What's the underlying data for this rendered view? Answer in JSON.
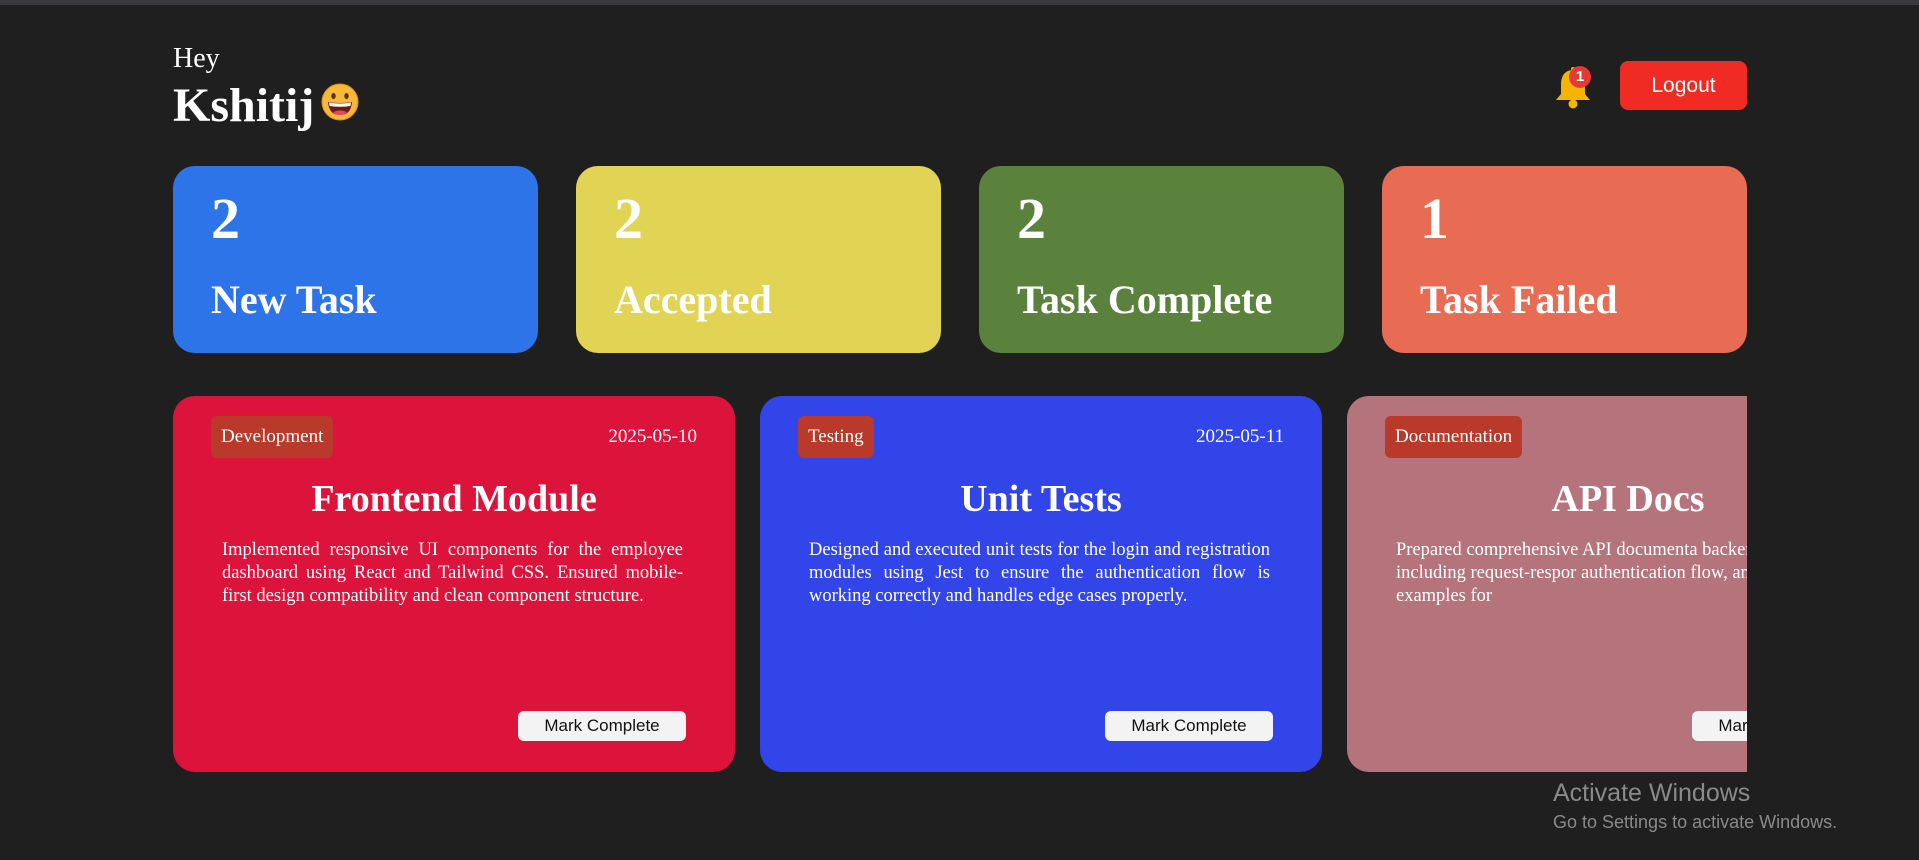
{
  "header": {
    "greeting": "Hey",
    "username": "Kshitij",
    "emoji_icon": "grinning-face-icon",
    "notifications": {
      "icon": "bell-icon",
      "count": "1",
      "bell_color": "#f5b400",
      "badge_color": "#e53935"
    },
    "logout_label": "Logout",
    "logout_color": "#ef2b24"
  },
  "stats": [
    {
      "count": "2",
      "label": "New Task",
      "color": "#2d74e8"
    },
    {
      "count": "2",
      "label": "Accepted",
      "color": "#e1d455"
    },
    {
      "count": "2",
      "label": "Task Complete",
      "color": "#5a823c"
    },
    {
      "count": "1",
      "label": "Task Failed",
      "color": "#e86c54"
    }
  ],
  "tasks": [
    {
      "category": "Development",
      "date": "2025-05-10",
      "title": "Frontend Module",
      "description": "Implemented responsive UI components for the employee dashboard using React and Tailwind CSS. Ensured mobile-first design compatibility and clean component structure.",
      "action_label": "Mark Complete",
      "color": "#dc143c"
    },
    {
      "category": "Testing",
      "date": "2025-05-11",
      "title": "Unit Tests",
      "description": "Designed and executed unit tests for the login and registration modules using Jest to ensure the authentication flow is working correctly and handles edge cases properly.",
      "action_label": "Mark Complete",
      "color": "#3245e8"
    },
    {
      "category": "Documentation",
      "date": "",
      "title": "API Docs",
      "description": "Prepared comprehensive API documenta backend services, including request-respor authentication flow, and usage examples for",
      "action_label": "Mark Complete",
      "color": "#b5737c"
    }
  ],
  "watermark": {
    "title": "Activate Windows",
    "subtitle": "Go to Settings to activate Windows."
  }
}
